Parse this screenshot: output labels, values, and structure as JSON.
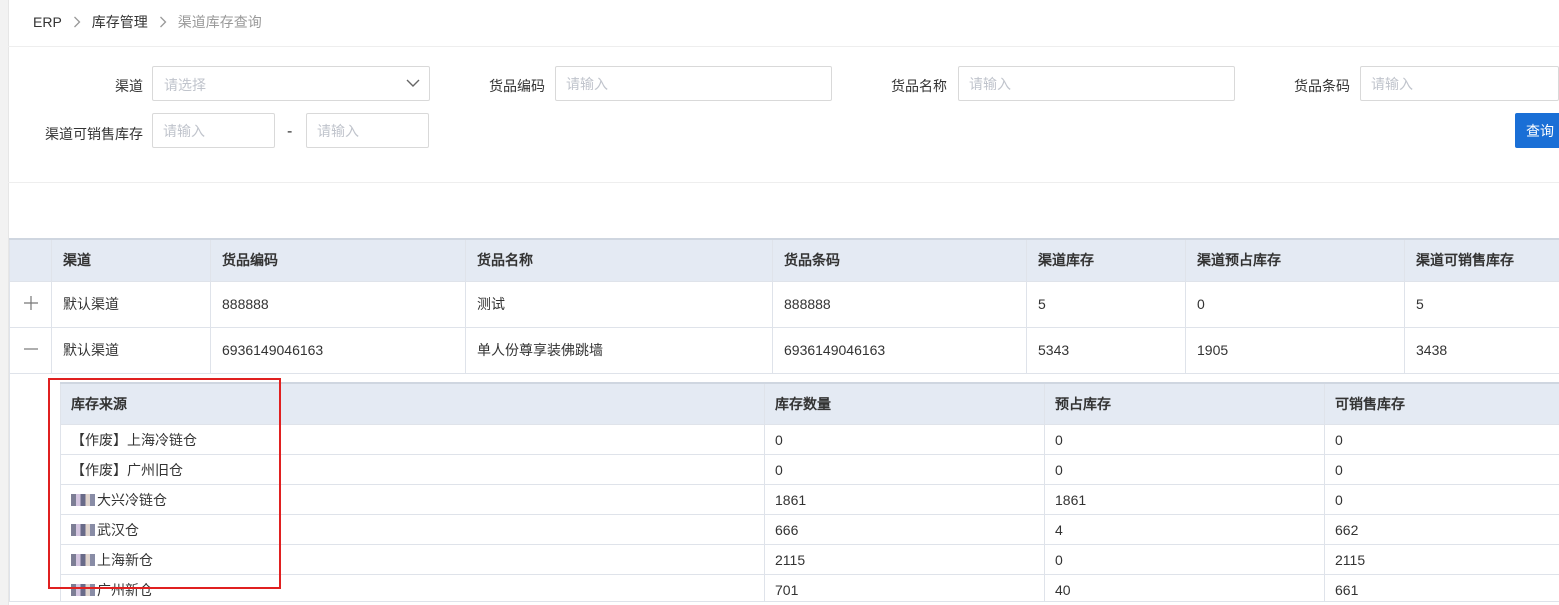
{
  "breadcrumb": [
    "ERP",
    "库存管理",
    "渠道库存查询"
  ],
  "filters": {
    "channel": {
      "label": "渠道",
      "placeholder": "请选择"
    },
    "sku_code": {
      "label": "货品编码",
      "placeholder": "请输入"
    },
    "sku_name": {
      "label": "货品名称",
      "placeholder": "请输入"
    },
    "barcode": {
      "label": "货品条码",
      "placeholder": "请输入"
    },
    "sellable": {
      "label": "渠道可销售库存",
      "min_placeholder": "请输入",
      "max_placeholder": "请输入",
      "separator": "-"
    },
    "query_button": "查询"
  },
  "table": {
    "columns": [
      "渠道",
      "货品编码",
      "货品名称",
      "货品条码",
      "渠道库存",
      "渠道预占库存",
      "渠道可销售库存"
    ],
    "rows": [
      {
        "expand_icon": "plus-icon",
        "channel": "默认渠道",
        "code": "888888",
        "name": "测试",
        "barcode": "888888",
        "stock": "5",
        "reserved": "0",
        "sellable": "5"
      },
      {
        "expand_icon": "minus-icon",
        "channel": "默认渠道",
        "code": "6936149046163",
        "name": "单人份尊享装佛跳墙",
        "barcode": "6936149046163",
        "stock": "5343",
        "reserved": "1905",
        "sellable": "3438"
      }
    ]
  },
  "subtable": {
    "columns": [
      "库存来源",
      "库存数量",
      "预占库存",
      "可销售库存"
    ],
    "rows": [
      {
        "source": "【作废】上海冷链仓",
        "qty": "0",
        "reserved": "0",
        "sellable": "0"
      },
      {
        "source": "【作废】广州旧仓",
        "qty": "0",
        "reserved": "0",
        "sellable": "0"
      },
      {
        "source": "大兴冷链仓",
        "qty": "1861",
        "reserved": "1861",
        "sellable": "0"
      },
      {
        "source": "武汉仓",
        "qty": "666",
        "reserved": "4",
        "sellable": "662"
      },
      {
        "source": "上海新仓",
        "qty": "2115",
        "reserved": "0",
        "sellable": "2115"
      },
      {
        "source": "广州新仓",
        "qty": "701",
        "reserved": "40",
        "sellable": "661"
      }
    ]
  },
  "colors": {
    "accent": "#1a6fd6",
    "header_bg": "#e4eaf3",
    "highlight_box": "#e02020"
  }
}
